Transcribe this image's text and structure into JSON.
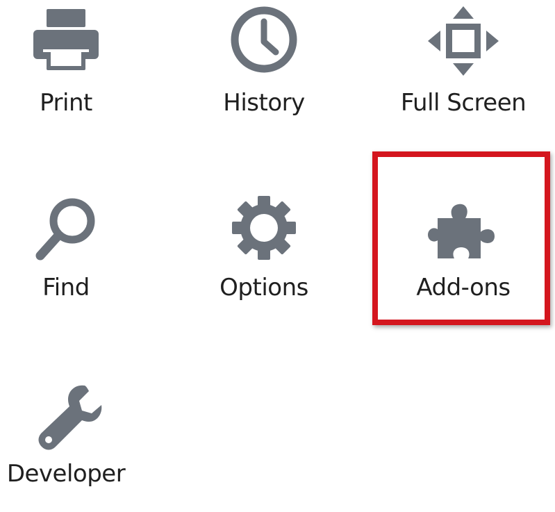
{
  "menu": {
    "items": [
      {
        "id": "print",
        "label": "Print",
        "icon": "printer-icon"
      },
      {
        "id": "history",
        "label": "History",
        "icon": "clock-icon"
      },
      {
        "id": "fullscreen",
        "label": "Full Screen",
        "icon": "fullscreen-arrows-icon"
      },
      {
        "id": "find",
        "label": "Find",
        "icon": "magnifier-icon"
      },
      {
        "id": "options",
        "label": "Options",
        "icon": "gear-icon"
      },
      {
        "id": "addons",
        "label": "Add-ons",
        "icon": "puzzle-piece-icon",
        "highlighted": true
      },
      {
        "id": "developer",
        "label": "Developer",
        "icon": "wrench-icon"
      }
    ]
  },
  "colors": {
    "icon": "#6b727b",
    "label": "#1f1f1f",
    "highlight": "#d4161e"
  }
}
